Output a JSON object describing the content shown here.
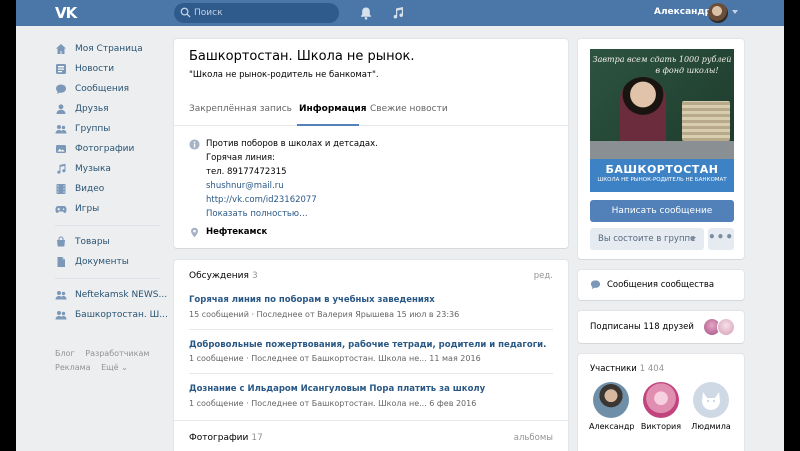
{
  "header": {
    "logo_text": "VK",
    "search_placeholder": "Поиск",
    "user_name": "Александр"
  },
  "nav": {
    "items": [
      {
        "label": "Моя Страница",
        "icon": "home-icon"
      },
      {
        "label": "Новости",
        "icon": "news-icon"
      },
      {
        "label": "Сообщения",
        "icon": "messages-icon"
      },
      {
        "label": "Друзья",
        "icon": "friends-icon"
      },
      {
        "label": "Группы",
        "icon": "groups-icon"
      },
      {
        "label": "Фотографии",
        "icon": "photos-icon"
      },
      {
        "label": "Музыка",
        "icon": "music-icon"
      },
      {
        "label": "Видео",
        "icon": "video-icon"
      },
      {
        "label": "Игры",
        "icon": "games-icon"
      }
    ],
    "items2": [
      {
        "label": "Товары",
        "icon": "goods-icon"
      },
      {
        "label": "Документы",
        "icon": "documents-icon"
      }
    ],
    "items3": [
      {
        "label": "Neftekamsk NEWS...",
        "icon": "community-icon"
      },
      {
        "label": "Башкортостан. Ш...",
        "icon": "community-icon"
      }
    ],
    "footer": {
      "blog": "Блог",
      "developers": "Разработчикам",
      "ads": "Реклама",
      "more": "Ещё ⌄"
    }
  },
  "group": {
    "title": "Башкортостан. Школа не рынок.",
    "status": "\"Школа не рынок-родитель не банкомат\".",
    "tabs": [
      "Закреплённая запись",
      "Информация",
      "Свежие новости"
    ],
    "info": {
      "desc1": "Против поборов в школах и детсадах.",
      "desc2": "Горячая линия:",
      "phone": "тел. 89177472315",
      "email": "shushnur@mail.ru",
      "link": "http://vk.com/id23162077",
      "show_more": "Показать полностью…",
      "location": "Нефтекамск"
    }
  },
  "discussions": {
    "title": "Обсуждения",
    "count": "3",
    "edit": "ред.",
    "topics": [
      {
        "title": "Горячая линия по поборам в учебных заведениях",
        "meta": "15 сообщений · Последнее от Валерия Ярышева 15 июл в 23:36"
      },
      {
        "title": "Добровольные пожертвования, рабочие тетради, родители и педагоги.",
        "meta": "1 сообщение · Последнее от Башкортостан. Школа не... 11 мая 2016"
      },
      {
        "title": "Дознание с Ильдаром Исангуловым Пора платить за школу",
        "meta": "1 сообщение · Последнее от Башкортостан. Школа не... 6 фев 2016"
      }
    ]
  },
  "photos": {
    "title": "Фотографии",
    "count": "17",
    "albums": "альбомы"
  },
  "cover": {
    "chalk_line1": "Завтра всем сдать 1000 рублей",
    "chalk_line2": "в фонд школы!",
    "banner_title": "БАШКОРТОСТАН",
    "banner_sub": "ШКОЛА НЕ РЫНОК-РОДИТЕЛЬ НЕ БАНКОМАТ"
  },
  "actions": {
    "send_message": "Написать сообщение",
    "member_status": "Вы состоите в группе",
    "more": "•••"
  },
  "community_messages": "Сообщения сообщества",
  "subscribed": "Подписаны 118 друзей",
  "members": {
    "title": "Участники",
    "count": "1 404",
    "list": [
      {
        "name": "Александр"
      },
      {
        "name": "Виктория"
      },
      {
        "name": "Людмила"
      }
    ]
  },
  "colors": {
    "header": "#4a76a8",
    "link": "#2a5885",
    "primary_button": "#5181b8",
    "background": "#edeef0"
  }
}
